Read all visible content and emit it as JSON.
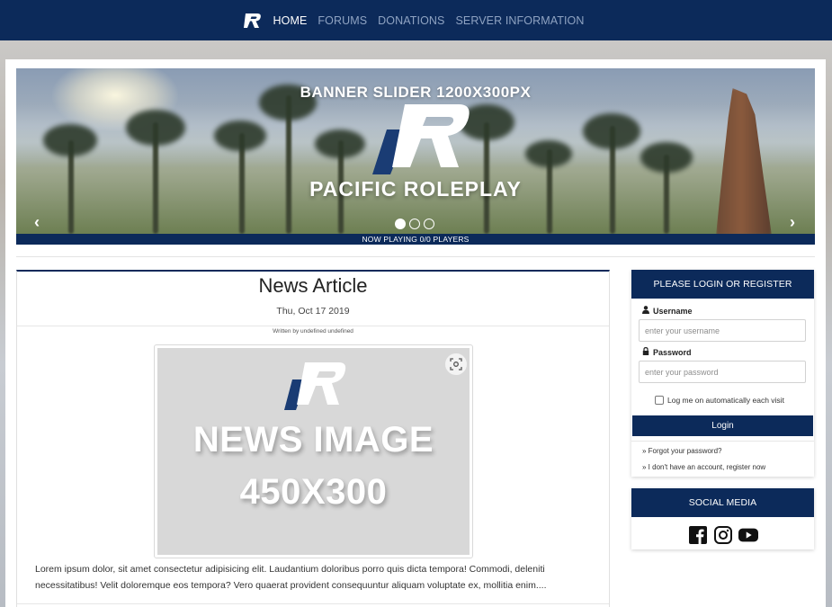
{
  "nav": {
    "brand_icon": "pacific-r-logo-icon",
    "items": [
      {
        "label": "HOME",
        "active": true
      },
      {
        "label": "FORUMS",
        "active": false
      },
      {
        "label": "DONATIONS",
        "active": false
      },
      {
        "label": "SERVER INFORMATION",
        "active": false
      }
    ]
  },
  "banner": {
    "title": "BANNER SLIDER 1200X300PX",
    "brand": "PACIFIC ROLEPLAY",
    "prev_icon": "‹",
    "next_icon": "›",
    "active_slide": 1,
    "slide_count": 3,
    "now_playing": "NOW PLAYING 0/0 PLAYERS"
  },
  "article": {
    "title": "News Article",
    "date": "Thu, Oct 17 2019",
    "author": "Written by undefined undefined",
    "image_line1": "NEWS IMAGE",
    "image_line2": "450X300",
    "zoom_icon": "expand-focus-icon",
    "body": "Lorem ipsum dolor, sit amet consectetur adipisicing elit. Laudantium doloribus porro quis dicta tempora! Commodi, deleniti necessitatibus! Velit doloremque eos tempora? Vero quaerat provident consequuntur aliquam voluptate ex, mollitia enim...."
  },
  "login": {
    "header": "PLEASE LOGIN OR REGISTER",
    "username_label": "Username",
    "username_placeholder": "enter your username",
    "username_value": "",
    "password_label": "Password",
    "password_placeholder": "enter your password",
    "password_value": "",
    "remember_label": "Log me on automatically each visit",
    "remember_checked": false,
    "button": "Login",
    "forgot": "» Forgot your password?",
    "register": "» I don't have an account, register now"
  },
  "social": {
    "header": "SOCIAL MEDIA",
    "icons": [
      "facebook-icon",
      "instagram-icon",
      "youtube-icon"
    ]
  },
  "colors": {
    "navy": "#0c2a5a",
    "nav_inactive": "#8fa3c2",
    "image_placeholder": "#d8d8d8"
  }
}
